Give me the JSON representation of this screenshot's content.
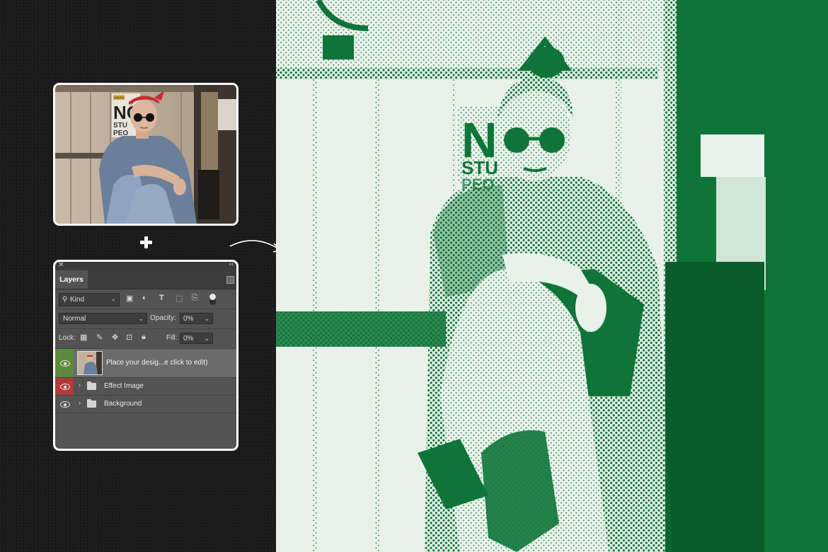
{
  "colors": {
    "effect_ink": "#0e7438",
    "effect_paper": "#e9f2ea",
    "layer_selected_eye": "#5c8a3c",
    "layer_hidden_eye": "#b23a3a"
  },
  "layers_panel": {
    "tab": "Layers",
    "filter": {
      "kind_label": "Kind",
      "icons": [
        "image-filter-icon",
        "adjustment-filter-icon",
        "type-filter-icon",
        "shape-filter-icon",
        "smart-object-filter-icon"
      ]
    },
    "blend_mode": "Normal",
    "opacity_label": "Opacity:",
    "opacity_value": "0%",
    "lock_label": "Lock:",
    "fill_label": "Fill:",
    "fill_value": "0%",
    "layers": [
      {
        "name": "Place your desig...e click to edit)",
        "type": "smart-object"
      },
      {
        "name": "Effect Image",
        "type": "group"
      },
      {
        "name": "Background",
        "type": "group"
      }
    ]
  },
  "photo_sign": {
    "line1": "NO",
    "line2": "STU",
    "line3": "PEO",
    "warning": "WARN"
  },
  "effect_sign": {
    "line1": "NO",
    "line2": "STU",
    "line3": "PEO"
  }
}
